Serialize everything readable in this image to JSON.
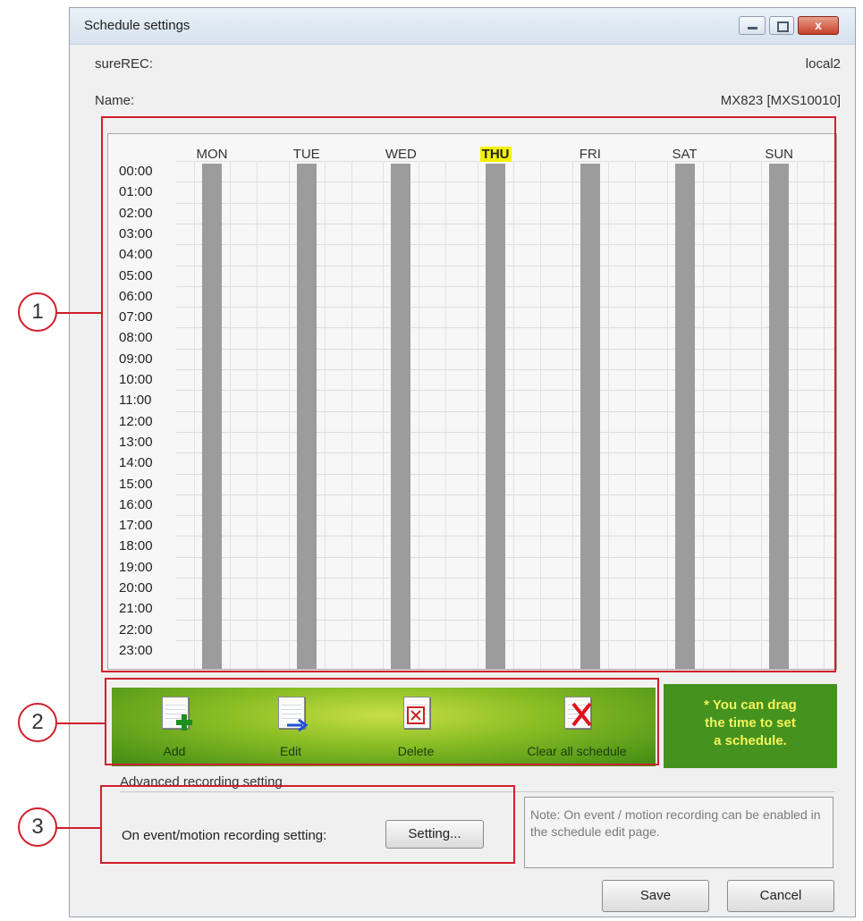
{
  "window": {
    "title": "Schedule settings",
    "close_glyph": "x"
  },
  "fields": {
    "surerec_label": "sureREC:",
    "surerec_value": "local2",
    "name_label": "Name:",
    "name_value": "MX823 [MXS10010]"
  },
  "schedule": {
    "days": [
      "MON",
      "TUE",
      "WED",
      "THU",
      "FRI",
      "SAT",
      "SUN"
    ],
    "highlighted_day": "THU",
    "times": [
      "00:00",
      "01:00",
      "02:00",
      "03:00",
      "04:00",
      "05:00",
      "06:00",
      "07:00",
      "08:00",
      "09:00",
      "10:00",
      "11:00",
      "12:00",
      "13:00",
      "14:00",
      "15:00",
      "16:00",
      "17:00",
      "18:00",
      "19:00",
      "20:00",
      "21:00",
      "22:00",
      "23:00"
    ]
  },
  "toolbar": {
    "add_label": "Add",
    "edit_label": "Edit",
    "delete_label": "Delete",
    "clear_label": "Clear all schedule",
    "icons": {
      "add": "document-add-icon",
      "edit": "document-edit-icon",
      "delete": "document-delete-icon",
      "clear": "document-clear-icon"
    }
  },
  "tip": {
    "line1": "* You can drag",
    "line2": "the time to set",
    "line3": "a schedule."
  },
  "advanced": {
    "section_label": "Advanced recording setting",
    "event_label": "On event/motion recording setting:",
    "setting_button": "Setting...",
    "note": "Note: On event / motion recording can be enabled in the schedule edit page."
  },
  "buttons": {
    "save": "Save",
    "cancel": "Cancel"
  },
  "callouts": [
    "1",
    "2",
    "3"
  ],
  "colors": {
    "annotation_red": "#d11f2b",
    "toolbar_green": "#5fa21c",
    "tip_text": "#f4f45a",
    "today_highlight": "#f2f200",
    "schedule_bar": "#9c9c9c"
  }
}
